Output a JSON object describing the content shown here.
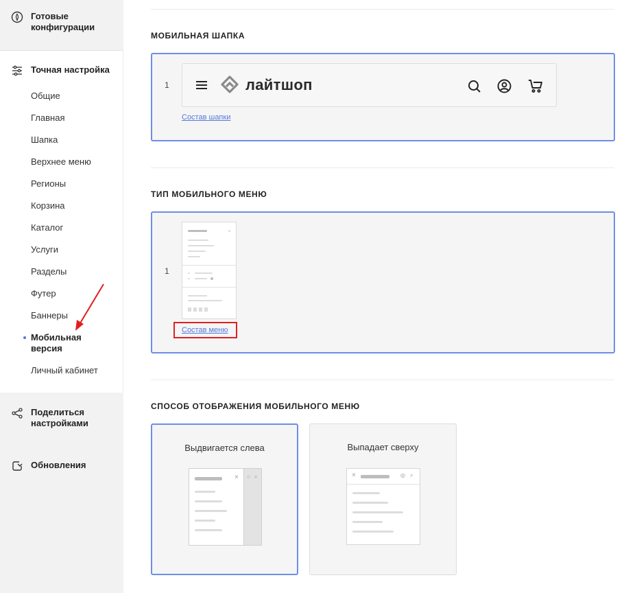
{
  "sidebar": {
    "ready_configs": "Готовые конфигурации",
    "fine_tuning": "Точная настройка",
    "items": [
      {
        "label": "Общие"
      },
      {
        "label": "Главная"
      },
      {
        "label": "Шапка"
      },
      {
        "label": "Верхнее меню"
      },
      {
        "label": "Регионы"
      },
      {
        "label": "Корзина"
      },
      {
        "label": "Каталог"
      },
      {
        "label": "Услуги"
      },
      {
        "label": "Разделы"
      },
      {
        "label": "Футер"
      },
      {
        "label": "Баннеры"
      },
      {
        "label": "Мобильная версия",
        "active": true
      },
      {
        "label": "Личный кабинет"
      }
    ],
    "share_settings": "Поделиться настройками",
    "updates": "Обновления"
  },
  "sections": {
    "mobile_header": {
      "title": "МОБИЛЬНАЯ ШАПКА",
      "index": "1",
      "logo_text": "лайтшоп",
      "link": "Состав шапки"
    },
    "mobile_menu_type": {
      "title": "ТИП МОБИЛЬНОГО МЕНЮ",
      "index": "1",
      "link": "Состав меню"
    },
    "menu_display": {
      "title": "СПОСОБ ОТОБРАЖЕНИЯ МОБИЛЬНОГО МЕНЮ",
      "options": [
        {
          "label": "Выдвигается слева",
          "selected": true
        },
        {
          "label": "Выпадает сверху",
          "selected": false
        }
      ]
    }
  },
  "colors": {
    "accent": "#6d8de6",
    "highlight": "#e01f1f",
    "sidebar_bg": "#f2f2f2"
  },
  "icons": [
    "fire-config-icon",
    "sliders-icon",
    "share-icon",
    "update-icon",
    "burger-icon",
    "logo-icon",
    "search-icon",
    "user-icon",
    "cart-icon"
  ]
}
